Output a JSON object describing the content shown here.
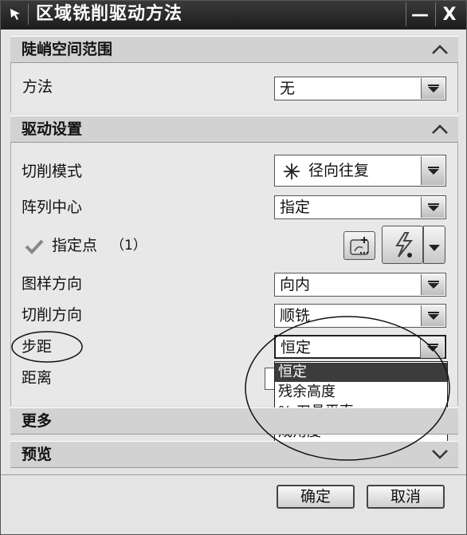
{
  "window": {
    "title": "区域铣削驱动方法",
    "minimize_label": "—",
    "close_label": "X"
  },
  "steep_section": {
    "title": "陡峭空间范围",
    "method_label": "方法",
    "method_value": "无"
  },
  "drive_section": {
    "title": "驱动设置",
    "cut_pattern_label": "切削模式",
    "cut_pattern_value": "径向往复",
    "pattern_center_label": "阵列中心",
    "pattern_center_value": "指定",
    "specify_point_label": "指定点",
    "specify_point_count": "（1）",
    "pattern_direction_label": "图样方向",
    "pattern_direction_value": "向内",
    "cut_direction_label": "切削方向",
    "cut_direction_value": "顺铣",
    "stepover_label": "步距",
    "stepover_value": "恒定",
    "distance_label": "距离",
    "stepover_options": [
      "恒定",
      "残余高度",
      "% 刀具平直",
      "成角度"
    ],
    "stepover_selected_index": 0
  },
  "more_section": {
    "title": "更多"
  },
  "preview_section": {
    "title": "预览"
  },
  "footer": {
    "ok_label": "确定",
    "cancel_label": "取消"
  },
  "icons": {
    "title": "arrow-pointer-icon",
    "chevron_up": "chevron-up-icon",
    "chevron_down": "chevron-down-icon",
    "dropdown_arrow": "dropdown-arrow-icon",
    "point_check": "checkmark-icon",
    "point_constructor": "point-constructor-icon",
    "inferred_point": "inferred-point-icon",
    "radial_pattern": "radial-pattern-icon"
  }
}
